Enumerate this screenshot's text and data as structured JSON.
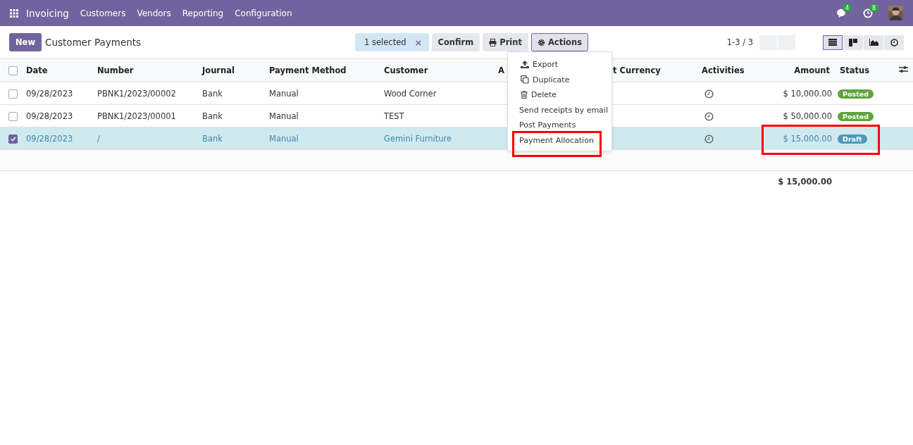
{
  "navbar": {
    "app_name": "Invoicing",
    "menu": [
      "Customers",
      "Vendors",
      "Reporting",
      "Configuration"
    ],
    "messages_count": "4",
    "activities_count": "8"
  },
  "control_panel": {
    "new_button": "New",
    "title": "Customer Payments",
    "selection": "1 selected",
    "clear_selection": "×",
    "buttons": [
      {
        "kind": "plain",
        "label": "Confirm"
      },
      {
        "kind": "print",
        "label": "Print"
      },
      {
        "kind": "actions",
        "label": "Actions"
      }
    ],
    "pager": "1-3 / 3",
    "views": [
      {
        "kind": "list",
        "selected": true
      },
      {
        "kind": "kanban",
        "selected": false
      },
      {
        "kind": "graph",
        "selected": false
      },
      {
        "kind": "activity",
        "selected": false
      }
    ]
  },
  "actions_menu": [
    {
      "kind": "export",
      "label": "Export",
      "highlighted": false
    },
    {
      "kind": "duplicate",
      "label": "Duplicate",
      "highlighted": false
    },
    {
      "kind": "delete",
      "label": "Delete",
      "highlighted": false
    },
    {
      "kind": "plain",
      "label": "Send receipts by email",
      "highlighted": false
    },
    {
      "kind": "plain",
      "label": "Post Payments",
      "highlighted": false
    },
    {
      "kind": "plain",
      "label": "Payment Allocation",
      "highlighted": true
    }
  ],
  "table": {
    "all_checked": false,
    "columns": [
      "Date",
      "Number",
      "Journal",
      "Payment Method",
      "Customer",
      "A",
      "t Currency",
      "Activities",
      "Amount",
      "Status"
    ],
    "rows": [
      {
        "selected": false,
        "highlighted": false,
        "date": "09/28/2023",
        "number": "PBNK1/2023/00002",
        "journal": "Bank",
        "payment_method": "Manual",
        "customer": "Wood Corner",
        "amount": "$ 10,000.00",
        "status": "Posted",
        "color": "#5fa43c"
      },
      {
        "selected": false,
        "highlighted": false,
        "date": "09/28/2023",
        "number": "PBNK1/2023/00001",
        "journal": "Bank",
        "payment_method": "Manual",
        "customer": "TEST",
        "amount": "$ 50,000.00",
        "status": "Posted",
        "color": "#5fa43c"
      },
      {
        "selected": true,
        "highlighted": true,
        "date": "09/28/2023",
        "number": "/",
        "journal": "Bank",
        "payment_method": "Manual",
        "customer": "Gemini Furniture",
        "amount": "$ 15,000.00",
        "status": "Draft",
        "color": "#4b9bb8"
      }
    ],
    "total": "$ 15,000.00"
  }
}
